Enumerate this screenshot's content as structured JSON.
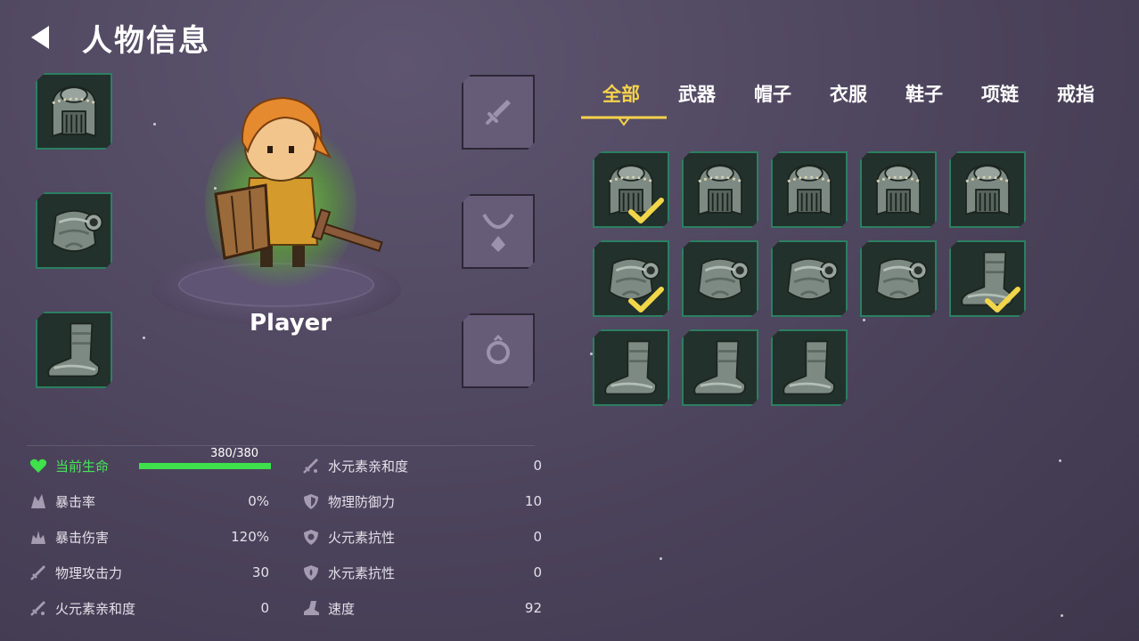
{
  "header": {
    "title": "人物信息"
  },
  "player": {
    "name": "Player"
  },
  "tabs": [
    {
      "label": "全部",
      "active": true
    },
    {
      "label": "武器",
      "active": false
    },
    {
      "label": "帽子",
      "active": false
    },
    {
      "label": "衣服",
      "active": false
    },
    {
      "label": "鞋子",
      "active": false
    },
    {
      "label": "项链",
      "active": false
    },
    {
      "label": "戒指",
      "active": false
    }
  ],
  "equipped": {
    "helmet": "helmet-icon",
    "armor": "armor-icon",
    "boots": "boots-icon",
    "weapon": "sword-slot-icon",
    "necklace": "necklace-slot-icon",
    "ring": "ring-slot-icon"
  },
  "inventory": [
    {
      "icon": "helmet-icon",
      "equipped": true
    },
    {
      "icon": "helmet-icon",
      "equipped": false
    },
    {
      "icon": "helmet-icon",
      "equipped": false
    },
    {
      "icon": "helmet-icon",
      "equipped": false
    },
    {
      "icon": "helmet-icon",
      "equipped": false
    },
    {
      "icon": "armor-icon",
      "equipped": true
    },
    {
      "icon": "armor-icon",
      "equipped": false
    },
    {
      "icon": "armor-icon",
      "equipped": false
    },
    {
      "icon": "armor-icon",
      "equipped": false
    },
    {
      "icon": "boots-icon",
      "equipped": true
    },
    {
      "icon": "boots-icon",
      "equipped": false
    },
    {
      "icon": "boots-icon",
      "equipped": false
    },
    {
      "icon": "boots-icon",
      "equipped": false
    }
  ],
  "stats": {
    "hp": {
      "label": "当前生命",
      "value": "380/380",
      "fraction": 1.0
    },
    "left": [
      {
        "label": "暴击率",
        "value": "0%",
        "icon": "crit-icon"
      },
      {
        "label": "暴击伤害",
        "value": "120%",
        "icon": "crit-damage-icon"
      },
      {
        "label": "物理攻击力",
        "value": "30",
        "icon": "sword-icon"
      },
      {
        "label": "火元素亲和度",
        "value": "0",
        "icon": "fire-sword-icon"
      }
    ],
    "right": [
      {
        "label": "水元素亲和度",
        "value": "0",
        "icon": "water-sword-icon"
      },
      {
        "label": "物理防御力",
        "value": "10",
        "icon": "shield-icon"
      },
      {
        "label": "火元素抗性",
        "value": "0",
        "icon": "fire-shield-icon"
      },
      {
        "label": "水元素抗性",
        "value": "0",
        "icon": "water-shield-icon"
      },
      {
        "label": "速度",
        "value": "92",
        "icon": "boot-speed-icon"
      }
    ]
  },
  "colors": {
    "accent": "#f4d24a",
    "hp": "#3ee04c",
    "slot_border": "#2c7f62"
  }
}
